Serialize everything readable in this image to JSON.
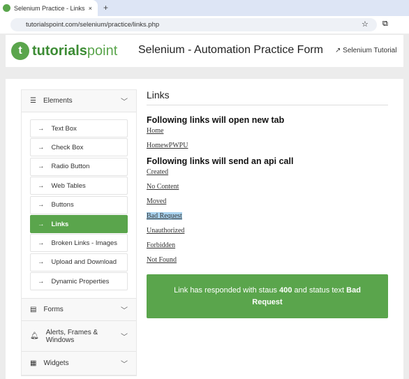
{
  "browser": {
    "tab_title": "Selenium Practice - Links",
    "close": "×",
    "new_tab": "+",
    "url": "tutorialspoint.com/selenium/practice/links.php"
  },
  "header": {
    "logo_a": "tutorials",
    "logo_b": "point",
    "title": "Selenium - Automation Practice Form",
    "tutorial_link": "Selenium Tutorial"
  },
  "sidebar": {
    "elements": "Elements",
    "items": [
      {
        "label": "Text Box"
      },
      {
        "label": "Check Box"
      },
      {
        "label": "Radio Button"
      },
      {
        "label": "Web Tables"
      },
      {
        "label": "Buttons"
      },
      {
        "label": "Links",
        "active": true
      },
      {
        "label": "Broken Links - Images"
      },
      {
        "label": "Upload and Download"
      },
      {
        "label": "Dynamic Properties"
      }
    ],
    "forms": "Forms",
    "alerts": "Alerts, Frames & Windows",
    "widgets": "Widgets"
  },
  "main": {
    "heading": "Links",
    "section1": "Following links will open new tab",
    "links1": [
      "Home",
      "HomewPWPU"
    ],
    "section2": "Following links will send an api call",
    "links2": [
      "Created",
      "No Content",
      "Moved",
      "Bad Request",
      "Unauthorized",
      "Forbidden",
      "Not Found"
    ],
    "response": {
      "prefix": "Link has responded with staus ",
      "status": "400",
      "middle": " and status text ",
      "text": "Bad Request"
    }
  },
  "colors": {
    "accent": "#5aa54c"
  }
}
